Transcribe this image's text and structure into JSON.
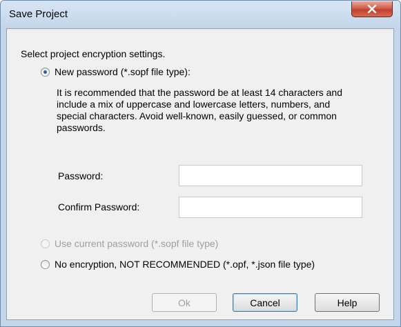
{
  "window": {
    "title": "Save Project"
  },
  "dialog": {
    "intro": "Select project encryption settings.",
    "new_password_option": "New password (*.sopf file type):",
    "recommendation_lines": [
      "It is recommended that the password be at least 14 characters and",
      "include a mix of uppercase and lowercase letters, numbers, and",
      "special characters. Avoid well-known, easily guessed, or common",
      "passwords."
    ],
    "password_label": "Password:",
    "password_value": "",
    "confirm_label": "Confirm Password:",
    "confirm_value": "",
    "current_password_option": "Use current password (*.sopf file type)",
    "no_encryption_option": "No encryption, NOT RECOMMENDED (*.opf, *.json file type)",
    "selected_option": "new_password"
  },
  "buttons": {
    "ok": "Ok",
    "cancel": "Cancel",
    "help": "Help"
  },
  "icons": {
    "close": "close-icon"
  },
  "colors": {
    "accent": "#2b5fa8",
    "close_button": "#c0402e"
  }
}
